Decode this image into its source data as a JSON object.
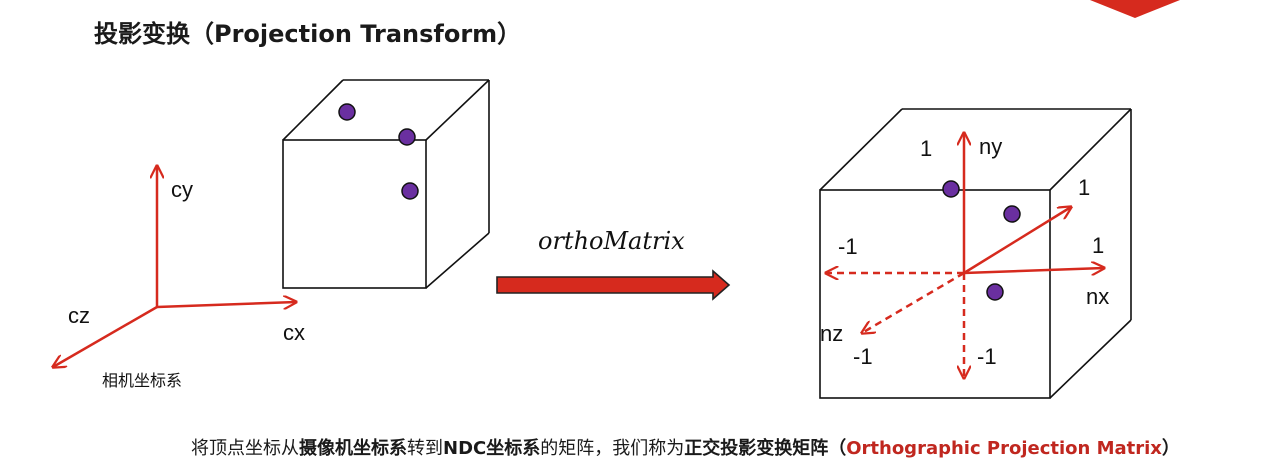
{
  "title": "投影变换（Projection Transform）",
  "colors": {
    "axis": "#d62a1e",
    "point": "#6a2fa0",
    "accent": "#c0271f"
  },
  "camera_frame": {
    "axis_y": "cy",
    "axis_x": "cx",
    "axis_z": "cz",
    "caption": "相机坐标系"
  },
  "transform": {
    "label": "orthoMatrix"
  },
  "ndc_cube": {
    "axis_y": "ny",
    "axis_x": "nx",
    "axis_z": "nz",
    "y_pos": "1",
    "x_pos": "1",
    "z_pos": "1",
    "x_neg": "-1",
    "z_neg": "-1",
    "y_neg": "-1"
  },
  "caption": {
    "part1": "将顶点坐标从",
    "part2": "摄像机坐标系",
    "part3": "转到",
    "part4": "NDC坐标系",
    "part5": "的矩阵，我们称为",
    "part6": "正交投影变换矩阵",
    "part7": "（",
    "part8": "Orthographic Projection Matrix",
    "part9": "）"
  }
}
